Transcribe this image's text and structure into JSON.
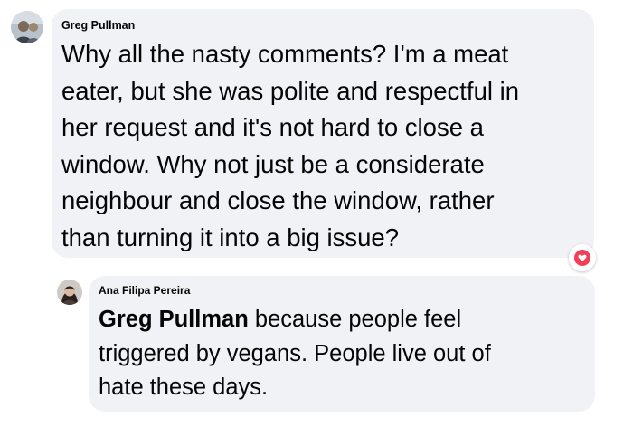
{
  "comment": {
    "author": "Greg Pullman",
    "avatar_icon": "user-avatar-icon",
    "lines": [
      "Why all the nasty comments? I'm a meat",
      "eater, but she was polite and respectful in",
      "her request and it's not hard to close a",
      "window. Why not just be a considerate",
      "neighbour and close the window, rather",
      "than turning it into a big issue?"
    ],
    "reaction_icon": "heart-reaction-icon",
    "reaction_color": "#f33e58"
  },
  "reply": {
    "author": "Ana Filipa Pereira",
    "avatar_icon": "user-avatar-icon",
    "mention": "Greg Pullman",
    "lines": [
      " because people feel",
      "triggered by vegans. People live out of",
      "hate these days."
    ]
  },
  "colors": {
    "bubble": "#f0f2f5",
    "text": "#050505"
  }
}
